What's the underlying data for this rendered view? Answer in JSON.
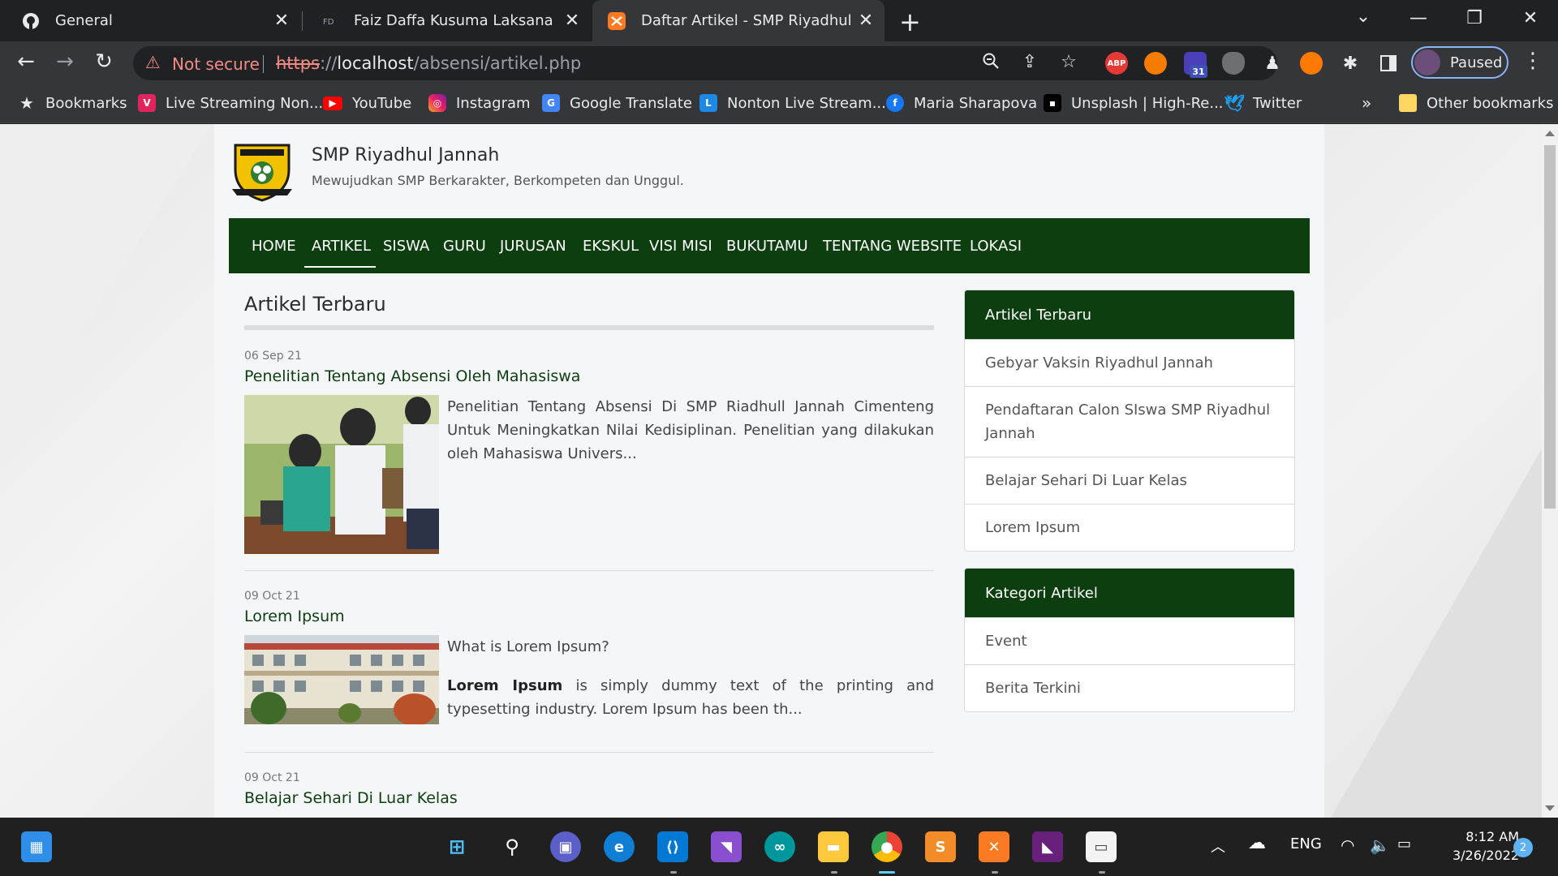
{
  "browser": {
    "tabs": [
      {
        "title": "General",
        "active": false
      },
      {
        "title": "Faiz Daffa Kusuma Laksana",
        "active": false
      },
      {
        "title": "Daftar Artikel - SMP Riyadhul Jannah",
        "active": true
      }
    ],
    "security_label": "Not secure",
    "url": {
      "scheme": "https",
      "rest": "://",
      "host": "localhost",
      "path": "/absensi/artikel.php"
    },
    "profile_label": "Paused",
    "extension_badge": "31",
    "abp_label": "ABP",
    "bookmarks": [
      {
        "label": "Bookmarks",
        "icon": "star-icon"
      },
      {
        "label": "Live Streaming Non...",
        "icon": "vidio-icon"
      },
      {
        "label": "YouTube",
        "icon": "youtube-icon"
      },
      {
        "label": "Instagram",
        "icon": "instagram-icon"
      },
      {
        "label": "Google Translate",
        "icon": "translate-icon"
      },
      {
        "label": "Nonton Live Stream...",
        "icon": "stream-icon"
      },
      {
        "label": "Maria Sharapova",
        "icon": "facebook-icon"
      },
      {
        "label": "Unsplash | High-Re...",
        "icon": "unsplash-icon"
      },
      {
        "label": "Twitter",
        "icon": "twitter-icon"
      }
    ],
    "bookmarks_overflow": "»",
    "other_bookmarks": "Other bookmarks"
  },
  "site": {
    "name": "SMP Riyadhul Jannah",
    "tagline": "Mewujudkan SMP Berkarakter, Berkompeten dan Unggul.",
    "nav": [
      "HOME",
      "ARTIKEL",
      "SISWA",
      "GURU",
      "JURUSAN",
      "EKSKUL",
      "VISI MISI",
      "BUKUTAMU",
      "TENTANG WEBSITE",
      "LOKASI"
    ],
    "nav_active": "ARTIKEL"
  },
  "main": {
    "section_title": "Artikel Terbaru",
    "articles": [
      {
        "date": "06 Sep 21",
        "title": "Penelitian Tentang Absensi Oleh Mahasiswa",
        "excerpt": "Penelitian Tentang Absensi Di SMP Riadhull Jannah Cimenteng Untuk Meningkatkan Nilai Kedisiplinan. Penelitian yang dilakukan oleh Mahasiswa Univers..."
      },
      {
        "date": "09 Oct 21",
        "title": "Lorem Ipsum",
        "excerpt_heading": "What is Lorem Ipsum?",
        "excerpt_bold": "Lorem Ipsum",
        "excerpt": " is simply dummy text of the printing and typesetting industry. Lorem Ipsum has been th..."
      },
      {
        "date": "09 Oct 21",
        "title": "Belajar Sehari Di Luar Kelas"
      }
    ]
  },
  "sidebar": {
    "recent": {
      "heading": "Artikel Terbaru",
      "items": [
        "Gebyar Vaksin Riyadhul Jannah",
        "Pendaftaran Calon SIswa SMP Riyadhul Jannah",
        "Belajar Sehari Di Luar Kelas",
        "Lorem Ipsum"
      ]
    },
    "categories": {
      "heading": "Kategori Artikel",
      "items": [
        "Event",
        "Berita Terkini"
      ]
    }
  },
  "taskbar": {
    "language": "ENG",
    "time": "8:12 AM",
    "date": "3/26/2022",
    "notification_count": "2"
  },
  "colors": {
    "brand_green": "#0c3e10",
    "chrome_dark": "#202124",
    "chrome_mid": "#35363a",
    "warning_red": "#f28b82"
  }
}
